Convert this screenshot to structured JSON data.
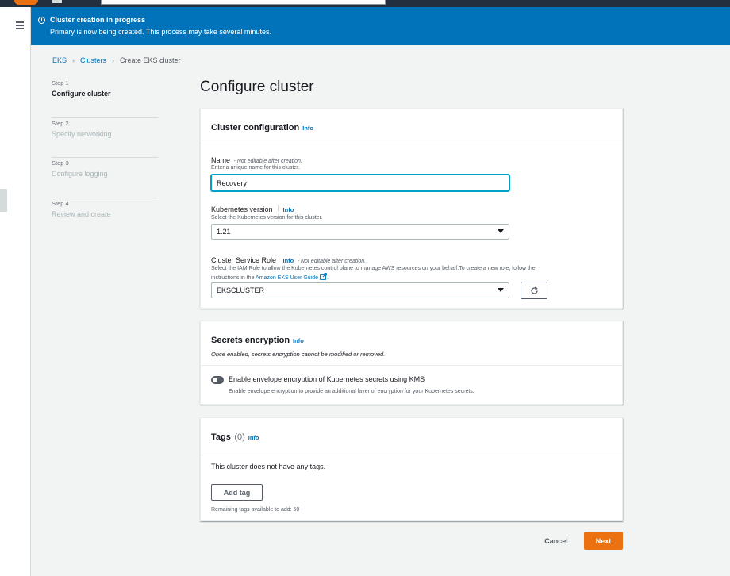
{
  "flash": {
    "title": "Cluster creation in progress",
    "message": "Primary is now being created. This process may take several minutes.",
    "icon": "info-icon"
  },
  "breadcrumbs": {
    "eks": "EKS",
    "clusters": "Clusters",
    "current": "Create EKS cluster"
  },
  "steps": [
    {
      "num": "Step 1",
      "label": "Configure cluster"
    },
    {
      "num": "Step 2",
      "label": "Specify networking"
    },
    {
      "num": "Step 3",
      "label": "Configure logging"
    },
    {
      "num": "Step 4",
      "label": "Review and create"
    }
  ],
  "page_title": "Configure cluster",
  "cluster_config": {
    "title": "Cluster configuration",
    "info": "Info",
    "name": {
      "label": "Name",
      "note": "- Not editable after creation.",
      "description": "Enter a unique name for this cluster.",
      "value": "Recovery"
    },
    "k8s_version": {
      "label": "Kubernetes version",
      "info": "Info",
      "description": "Select the Kubernetes version for this cluster.",
      "value": "1.21"
    },
    "service_role": {
      "label": "Cluster Service Role",
      "info": "Info",
      "note": "- Not editable after creation.",
      "description_1": "Select the IAM Role to allow the Kubernetes control plane to manage AWS resources on your behalf.To create a new role, follow the",
      "description_2": "instructions in the",
      "link": "Amazon EKS User Guide",
      "tail": ".",
      "value": "EKSCLUSTER"
    }
  },
  "secrets": {
    "title": "Secrets encryption",
    "info": "Info",
    "description": "Once enabled, secrets encryption cannot be modified or removed.",
    "toggle_label": "Enable envelope encryption of Kubernetes secrets using KMS",
    "toggle_description": "Enable envelope encryption to provide an additional layer of encryption for your Kubernetes secrets.",
    "enabled": false
  },
  "tags": {
    "title": "Tags",
    "count": "(0)",
    "info": "Info",
    "empty": "This cluster does not have any tags.",
    "add_label": "Add tag",
    "remaining": "Remaining tags available to add: 50"
  },
  "footer": {
    "cancel": "Cancel",
    "next": "Next"
  },
  "colors": {
    "flash_bg": "#0073bb",
    "primary": "#ec7211",
    "link": "#0073bb"
  }
}
